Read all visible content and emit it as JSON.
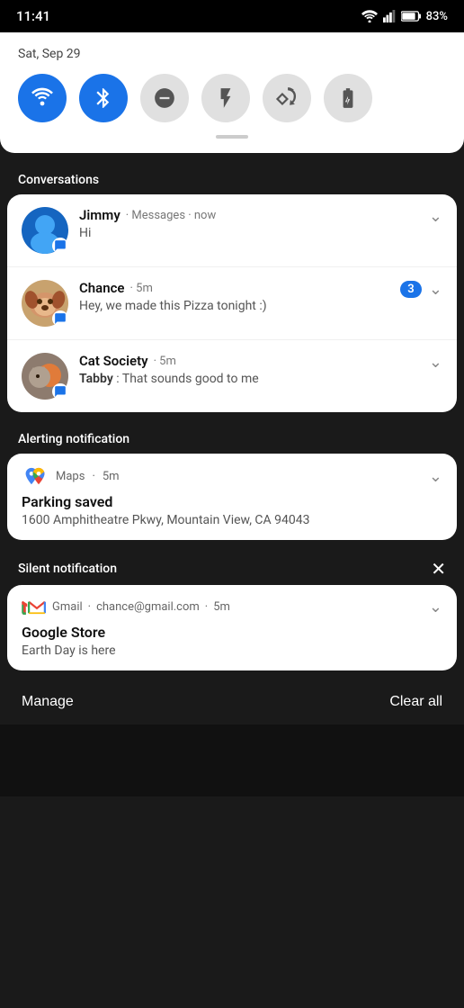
{
  "statusBar": {
    "time": "11:41",
    "battery": "83%"
  },
  "quickSettings": {
    "date": "Sat, Sep 29",
    "toggles": [
      {
        "id": "wifi",
        "label": "Wi-Fi",
        "active": true,
        "icon": "wifi"
      },
      {
        "id": "bluetooth",
        "label": "Bluetooth",
        "active": true,
        "icon": "bluetooth"
      },
      {
        "id": "dnd",
        "label": "Do Not Disturb",
        "active": false,
        "icon": "dnd"
      },
      {
        "id": "flashlight",
        "label": "Flashlight",
        "active": false,
        "icon": "flashlight"
      },
      {
        "id": "rotate",
        "label": "Auto Rotate",
        "active": false,
        "icon": "rotate"
      },
      {
        "id": "battery_saver",
        "label": "Battery Saver",
        "active": false,
        "icon": "battery_plus"
      }
    ]
  },
  "sections": {
    "conversations": {
      "title": "Conversations",
      "items": [
        {
          "sender": "Jimmy",
          "app": "Messages",
          "time": "now",
          "message": "Hi",
          "badge": null
        },
        {
          "sender": "Chance",
          "app": "",
          "time": "5m",
          "message": "Hey, we made this Pizza tonight :)",
          "badge": "3"
        },
        {
          "sender": "Cat Society",
          "app": "",
          "time": "5m",
          "senderPrefix": "Tabby",
          "message": "That sounds good to me",
          "badge": null
        }
      ]
    },
    "alerting": {
      "title": "Alerting notification",
      "app": "Maps",
      "time": "5m",
      "notifTitle": "Parking saved",
      "notifBody": "1600 Amphitheatre Pkwy, Mountain View, CA 94043"
    },
    "silent": {
      "title": "Silent notification",
      "app": "Gmail",
      "email": "chance@gmail.com",
      "time": "5m",
      "notifTitle": "Google Store",
      "notifBody": "Earth Day is here"
    }
  },
  "bottomBar": {
    "manageLabel": "Manage",
    "clearAllLabel": "Clear all"
  }
}
